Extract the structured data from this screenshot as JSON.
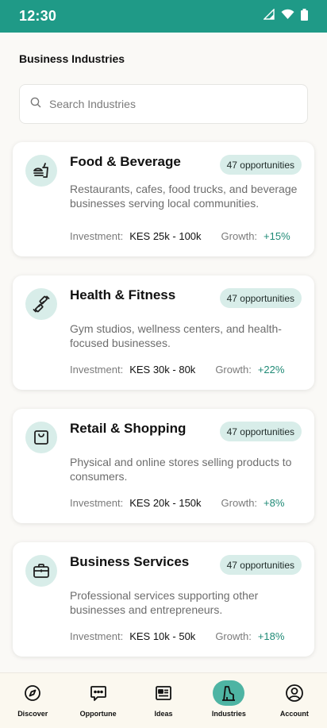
{
  "status_bar": {
    "time": "12:30"
  },
  "page": {
    "title": "Business Industries"
  },
  "search": {
    "placeholder": "Search Industries"
  },
  "colors": {
    "primary": "#1f9a87",
    "accent_light": "#d8ede9",
    "growth": "#1f8a76",
    "nav_active": "#4eb4a3"
  },
  "industries": [
    {
      "icon": "food-beverage-icon",
      "title": "Food & Beverage",
      "badge": "47 opportunities",
      "description": "Restaurants, cafes, food trucks, and beverage businesses serving local communities.",
      "investment_label": "Investment:",
      "investment": "KES 25k - 100k",
      "growth_label": "Growth:",
      "growth": "+15%"
    },
    {
      "icon": "dumbbell-icon",
      "title": "Health & Fitness",
      "badge": "47 opportunities",
      "description": "Gym studios, wellness centers, and health-focused businesses.",
      "investment_label": "Investment:",
      "investment": "KES 30k - 80k",
      "growth_label": "Growth:",
      "growth": "+22%"
    },
    {
      "icon": "shopping-bag-icon",
      "title": "Retail & Shopping",
      "badge": "47 opportunities",
      "description": "Physical and online stores selling products to consumers.",
      "investment_label": "Investment:",
      "investment": "KES 20k - 150k",
      "growth_label": "Growth:",
      "growth": "+8%"
    },
    {
      "icon": "briefcase-icon",
      "title": "Business Services",
      "badge": "47 opportunities",
      "description": "Professional services supporting other businesses and entrepreneurs.",
      "investment_label": "Investment:",
      "investment": "KES 10k - 50k",
      "growth_label": "Growth:",
      "growth": "+18%"
    }
  ],
  "nav": {
    "active": "Industries",
    "items": [
      {
        "label": "Discover",
        "icon": "compass-icon"
      },
      {
        "label": "Opportune",
        "icon": "chat-bubble-icon"
      },
      {
        "label": "Ideas",
        "icon": "newspaper-icon"
      },
      {
        "label": "Industries",
        "icon": "factory-icon"
      },
      {
        "label": "Account",
        "icon": "account-icon"
      }
    ]
  }
}
